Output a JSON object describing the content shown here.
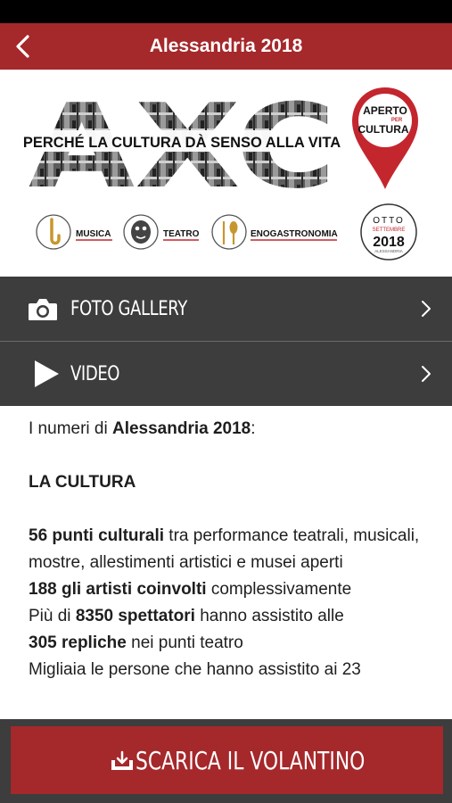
{
  "navbar": {
    "title": "Alessandria 2018",
    "back_icon": "chevron-left-icon"
  },
  "banner": {
    "logo_letters": "AXC",
    "tagline": "PERCHÉ LA CULTURA DÀ SENSO ALLA VITA",
    "pin": {
      "line1": "APERTO",
      "line2": "PER",
      "line3": "CULTURA"
    },
    "categories": [
      "MUSICA",
      "TEATRO",
      "ENOGASTRONOMIA"
    ],
    "badge": {
      "top": "OTTO",
      "middle": "SETTEMBRE",
      "year": "2018",
      "bottom": "ALESSANDRIA"
    }
  },
  "menu": [
    {
      "label": "FOTO GALLERY",
      "icon": "camera-icon"
    },
    {
      "label": "VIDEO",
      "icon": "play-icon"
    }
  ],
  "content": {
    "intro_prefix": "I numeri di ",
    "intro_bold": "Alessandria 2018",
    "intro_suffix": ":",
    "section_title": "LA CULTURA",
    "p1_bold": "56 punti culturali",
    "p1_text": " tra performance teatrali, musicali, mostre, allestimenti artistici e musei aperti",
    "p2_bold": "188 gli artisti coinvolti",
    "p2_text": " complessivamente",
    "p3_prefix": "Più di ",
    "p3_bold": "8350 spettatori",
    "p3_text": " hanno assistito alle",
    "p4_bold": "305 repliche",
    "p4_text": " nei punti teatro",
    "p5_text": "Migliaia le persone che hanno assistito ai 23"
  },
  "download": {
    "label": "SCARICA IL VOLANTINO",
    "icon": "download-tray-icon"
  },
  "colors": {
    "brand_red": "#a5282b",
    "menu_dark": "#3d3d3d"
  }
}
